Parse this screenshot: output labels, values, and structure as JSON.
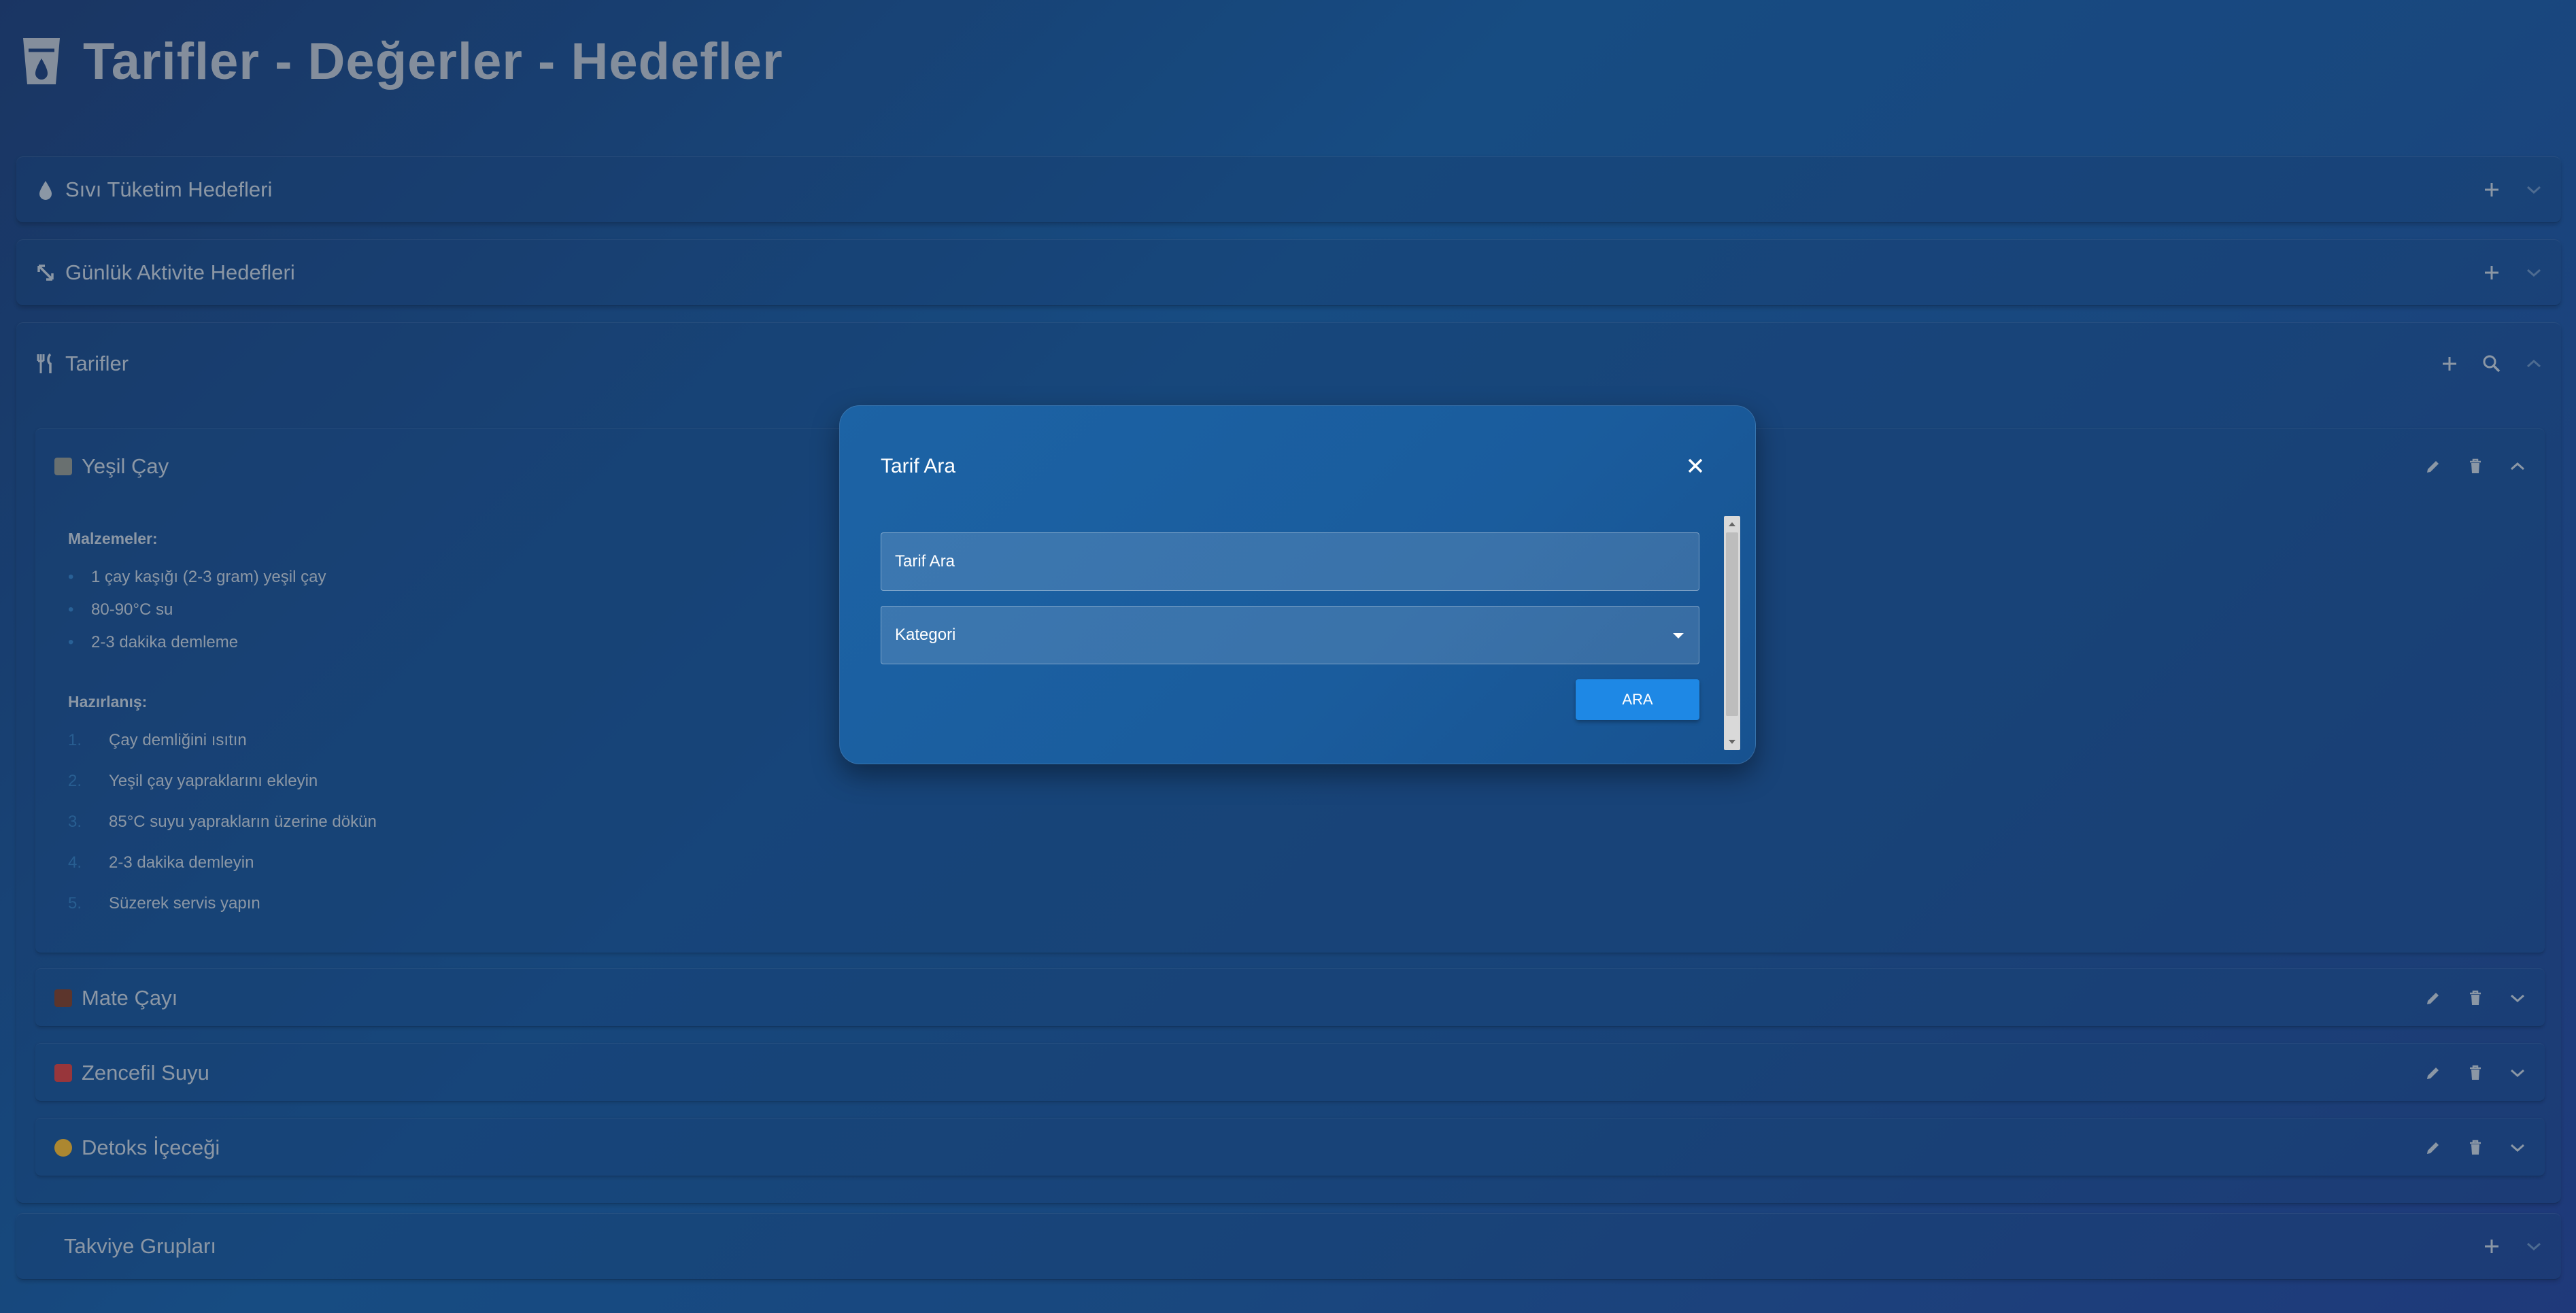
{
  "header": {
    "title": "Tarifler - Değerler - Hedefler",
    "icon": "cup-icon"
  },
  "sections": {
    "liquid": {
      "title": "Sıvı Tüketim Hedefleri",
      "icon": "drop-icon"
    },
    "activity": {
      "title": "Günlük Aktivite Hedefleri",
      "icon": "arrows-icon"
    },
    "recipes": {
      "title": "Tarifler",
      "icon": "utensils-icon"
    },
    "supplements": {
      "title": "Takviye Grupları"
    }
  },
  "recipes": [
    {
      "title": "Yeşil Çay",
      "expanded": true,
      "ingredients_label": "Malzemeler:",
      "ingredients": [
        "1 çay kaşığı (2-3 gram) yeşil çay",
        "80-90°C su",
        "2-3 dakika demleme"
      ],
      "steps_label": "Hazırlanış:",
      "steps": [
        {
          "num": "1.",
          "text": "Çay demliğini ısıtın"
        },
        {
          "num": "2.",
          "text": "Yeşil çay yapraklarını ekleyin"
        },
        {
          "num": "3.",
          "text": "85°C suyu yaprakların üzerine dökün"
        },
        {
          "num": "4.",
          "text": "2-3 dakika demleyin"
        },
        {
          "num": "5.",
          "text": "Süzerek servis yapın"
        }
      ]
    },
    {
      "title": "Mate Çayı",
      "expanded": false
    },
    {
      "title": "Zencefil Suyu",
      "expanded": false
    },
    {
      "title": "Detoks İçeceği",
      "expanded": false
    }
  ],
  "modal": {
    "title": "Tarif Ara",
    "search_placeholder": "Tarif Ara",
    "category_label": "Kategori",
    "search_button": "ARA"
  },
  "colors": {
    "accent": "#1e88e5",
    "modal_bg": "#1a5c9d"
  }
}
